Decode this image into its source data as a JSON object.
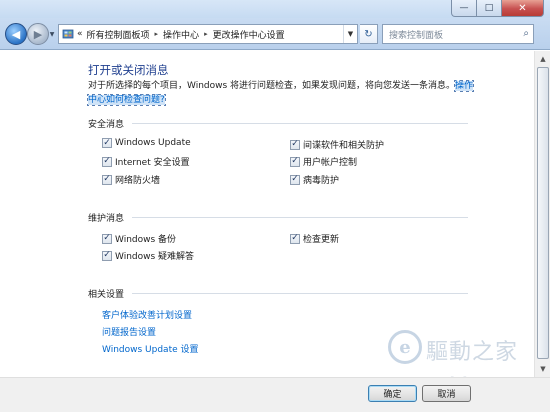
{
  "window": {
    "minimize_glyph": "—",
    "maximize_glyph": "□",
    "close_glyph": "✕"
  },
  "nav": {
    "back_glyph": "◀",
    "forward_glyph": "▶",
    "recent_glyph": "▼",
    "breadcrumb_prefix": "«",
    "breadcrumbs": [
      "所有控制面板项",
      "操作中心",
      "更改操作中心设置"
    ],
    "crumb_separator": "▸",
    "dropdown_glyph": "▼",
    "refresh_glyph": "↻",
    "search_placeholder": "搜索控制面板",
    "search_glyph": "⌕"
  },
  "content": {
    "title": "打开或关闭消息",
    "intro_text": "对于所选择的每个项目，Windows 将进行问题检查，如果发现问题，将向您发送一条消息。",
    "intro_link": "操作中心如何检查问题?",
    "security": {
      "heading": "安全消息",
      "items": [
        {
          "label": "Windows Update",
          "checked": true
        },
        {
          "label": "间谍软件和相关防护",
          "checked": true
        },
        {
          "label": "Internet 安全设置",
          "checked": true
        },
        {
          "label": "用户帐户控制",
          "checked": true
        },
        {
          "label": "网络防火墙",
          "checked": true
        },
        {
          "label": "病毒防护",
          "checked": true
        }
      ]
    },
    "maintenance": {
      "heading": "维护消息",
      "items": [
        {
          "label": "Windows 备份",
          "checked": true
        },
        {
          "label": "检查更新",
          "checked": true
        },
        {
          "label": "Windows 疑难解答",
          "checked": true
        }
      ]
    },
    "related": {
      "heading": "相关设置",
      "links": [
        "客户体验改善计划设置",
        "问题报告设置",
        "Windows Update 设置"
      ]
    }
  },
  "scrollbar": {
    "up_glyph": "▲",
    "down_glyph": "▼"
  },
  "buttons": {
    "ok": "确定",
    "cancel": "取消"
  },
  "watermark": {
    "chinese": "驅動之家",
    "url": "Mydrivers.com"
  },
  "colors": {
    "title_blue": "#1f3f8f",
    "link_blue": "#0066cc",
    "titlebar": "#c6dbf2"
  }
}
